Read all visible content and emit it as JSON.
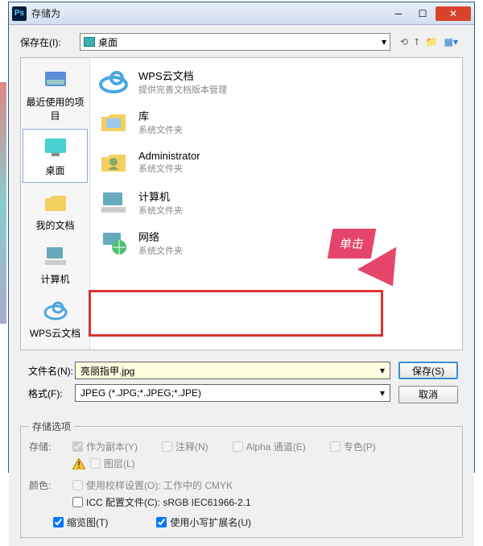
{
  "window": {
    "title": "存储为",
    "ps_icon_label": "Ps"
  },
  "save_in": {
    "label": "保存在(I):",
    "value": "桌面"
  },
  "places": [
    {
      "id": "recent",
      "label": "最近使用的项目"
    },
    {
      "id": "desktop",
      "label": "桌面"
    },
    {
      "id": "mydocs",
      "label": "我的文档"
    },
    {
      "id": "computer",
      "label": "计算机"
    },
    {
      "id": "wps",
      "label": "WPS云文档"
    }
  ],
  "files": [
    {
      "name": "WPS云文档",
      "sub": "提供完善文档版本管理"
    },
    {
      "name": "库",
      "sub": "系统文件夹"
    },
    {
      "name": "Administrator",
      "sub": "系统文件夹"
    },
    {
      "name": "计算机",
      "sub": "系统文件夹"
    },
    {
      "name": "网络",
      "sub": "系统文件夹"
    }
  ],
  "filename": {
    "label": "文件名(N):",
    "value": "亮丽指甲.jpg"
  },
  "format": {
    "label": "格式(F):",
    "value": "JPEG (*.JPG;*.JPEG;*.JPE)"
  },
  "buttons": {
    "save": "保存(S)",
    "cancel": "取消"
  },
  "callout": {
    "text": "单击"
  },
  "options": {
    "legend": "存储选项",
    "store_label": "存储:",
    "copy": "作为副本(Y)",
    "notes": "注释(N)",
    "alpha": "Alpha 通道(E)",
    "spot": "专色(P)",
    "layers": "图层(L)",
    "color_label": "颜色:",
    "proof": "使用校样设置(O): 工作中的 CMYK",
    "icc": "ICC 配置文件(C): sRGB IEC61966-2.1",
    "thumb": "缩览图(T)",
    "lowercase": "使用小写扩展名(U)"
  }
}
